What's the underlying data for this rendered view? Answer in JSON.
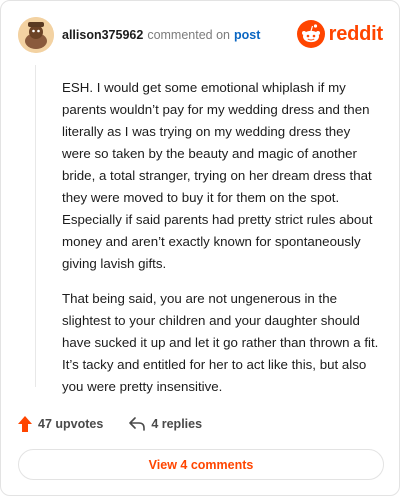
{
  "comment": {
    "username": "allison375962",
    "commented_text": "commented on",
    "post_link": "post",
    "body": [
      "ESH. I would get some emotional whiplash if my parents wouldn’t pay for my wedding dress and then literally as I was trying on my wedding dress they were so taken by the beauty and magic of another bride, a total stranger, trying on her dream dress that they were moved to buy it for them on the spot. Especially if said parents had pretty strict rules about money and aren’t exactly known for spontaneously giving lavish gifts.",
      "That being said, you are not ungenerous in the slightest to your children and your daughter should have sucked it up and let it go rather than thrown a fit. It’s tacky and entitled for her to act like this, but also you were pretty insensitive."
    ],
    "upvotes": "47 upvotes",
    "replies": "4 replies"
  },
  "brand": {
    "name": "reddit",
    "icon": "reddit-logo-icon",
    "color": "#ff4500"
  },
  "view_button": {
    "label": "View 4 comments"
  },
  "colors": {
    "accent": "#ff4500",
    "link": "#0a66c2",
    "muted": "#7c7c7c"
  }
}
